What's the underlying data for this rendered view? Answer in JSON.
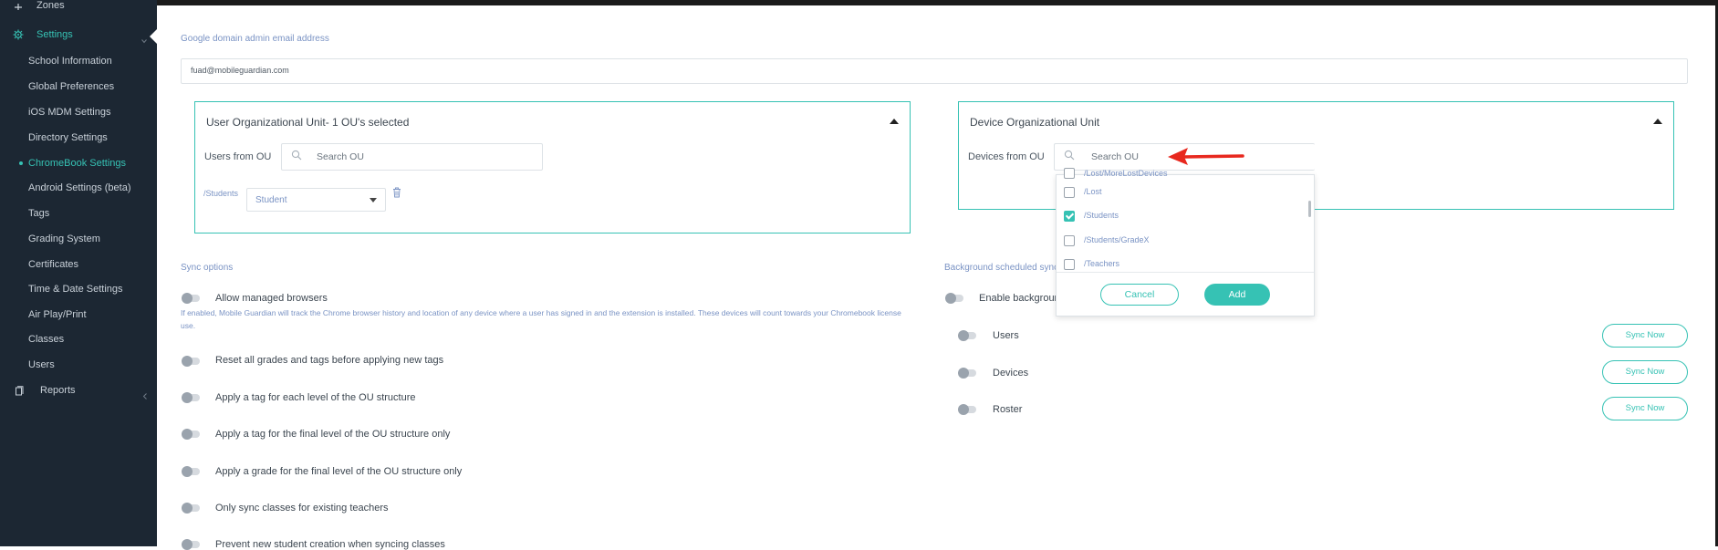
{
  "sidebar": {
    "zones_label": "Zones",
    "settings_label": "Settings",
    "items": [
      {
        "label": "School Information"
      },
      {
        "label": "Global Preferences"
      },
      {
        "label": "iOS MDM Settings"
      },
      {
        "label": "Directory Settings"
      },
      {
        "label": "ChromeBook Settings",
        "active": true
      },
      {
        "label": "Android Settings (beta)"
      },
      {
        "label": "Tags"
      },
      {
        "label": "Grading System"
      },
      {
        "label": "Certificates"
      },
      {
        "label": "Time & Date Settings"
      },
      {
        "label": "Air Play/Print"
      },
      {
        "label": "Classes"
      },
      {
        "label": "Users"
      }
    ],
    "reports_label": "Reports"
  },
  "main": {
    "admin_email_label": "Google domain admin email address",
    "admin_email_value": "fuad@mobileguardian.com",
    "user_ou": {
      "title": "User Organizational Unit- 1 OU's selected",
      "users_from_label": "Users from OU",
      "search_placeholder": "Search OU",
      "selected_path": "/Students",
      "selected_role": "Student"
    },
    "device_ou": {
      "title": "Device Organizational Unit",
      "devices_from_label": "Devices from OU",
      "search_placeholder": "Search OU"
    },
    "dropdown": {
      "items": [
        {
          "label": "/Lost",
          "checked": false
        },
        {
          "label": "/Students",
          "checked": true
        },
        {
          "label": "/Students/GradeX",
          "checked": false
        }
      ],
      "partial_top": "/Lost/MoreLostDevices",
      "partial_bottom": "/Teachers",
      "cancel_label": "Cancel",
      "add_label": "Add"
    },
    "sync_options": {
      "title": "Sync options",
      "options": [
        {
          "label": "Allow managed browsers"
        },
        {
          "label": "Reset all grades and tags before applying new tags"
        },
        {
          "label": "Apply a tag for each level of the OU structure"
        },
        {
          "label": "Apply a tag for the final level of the OU structure only"
        },
        {
          "label": "Apply a grade for the final level of the OU structure only"
        },
        {
          "label": "Only sync classes for existing teachers"
        },
        {
          "label": "Prevent new student creation when syncing classes"
        }
      ],
      "managed_browsers_help": "If enabled, Mobile Guardian will track the Chrome browser history and location of any device where a user has signed in and the extension is installed. These devices will count towards your Chromebook license use."
    },
    "background_sync": {
      "title": "Background scheduled sync",
      "enable_label": "Enable background sync",
      "rows": [
        {
          "label": "Users",
          "button": "Sync Now"
        },
        {
          "label": "Devices",
          "button": "Sync Now"
        },
        {
          "label": "Roster",
          "button": "Sync Now"
        }
      ]
    }
  },
  "colors": {
    "sidebar_bg": "#1c2733",
    "accent": "#36c2b4",
    "arrow": "#e8281e",
    "label_blue": "#7a93c4"
  },
  "icons": [
    "gear-icon",
    "location-icon",
    "reports-icon",
    "search-icon",
    "trash-icon",
    "chevron-up-icon",
    "caret-down-icon",
    "red-arrow-icon"
  ]
}
